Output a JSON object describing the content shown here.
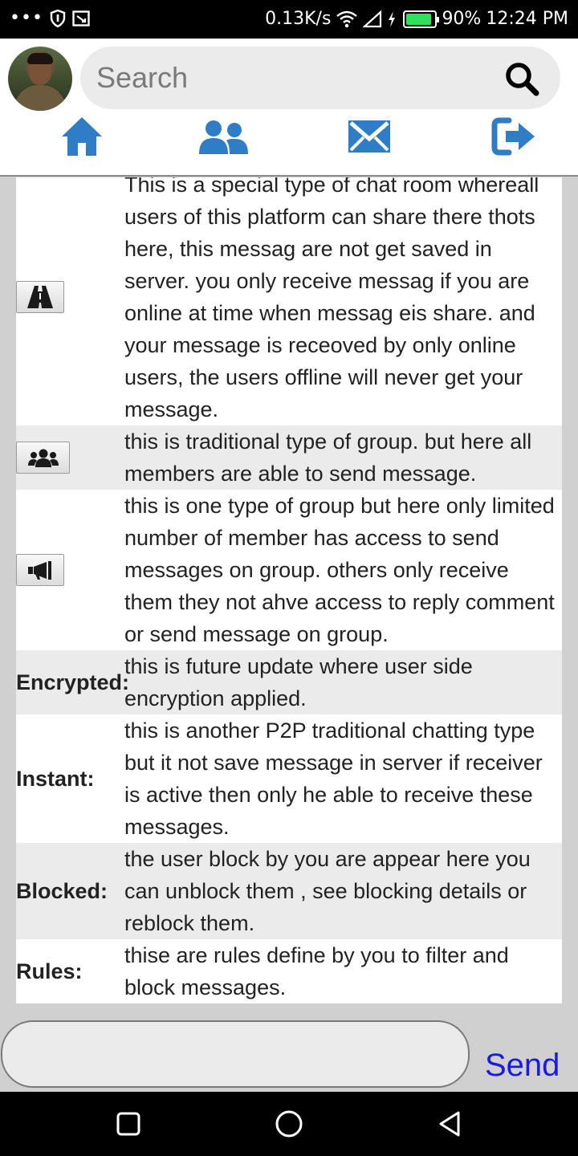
{
  "status_bar": {
    "speed": "0.13K/s",
    "battery": "90%",
    "battery_level": 0.9,
    "time": "12:24 PM",
    "icons": [
      "more-icon",
      "shield-icon",
      "cast-icon",
      "wifi-icon",
      "signal-icon",
      "charging-icon",
      "battery-icon"
    ]
  },
  "header": {
    "search_placeholder": "Search",
    "nav": [
      "home-icon",
      "users-icon",
      "envelope-icon",
      "logout-icon"
    ]
  },
  "rows": [
    {
      "label": "",
      "icon": "road-icon",
      "text": "This is a special type of chat room whereall users of this platform can share there thots here, this messag are not get saved in server. you only receive messag if you are online at time when messag eis share. and your message is receoved by only online users, the users offline will never get your message."
    },
    {
      "label": "",
      "icon": "group-icon",
      "text": "this is traditional type of group. but here all members are able to send message."
    },
    {
      "label": "",
      "icon": "bullhorn-icon",
      "text": "this is one type of group but here only limited number of member has access to send messages on group. others only receive them they not ahve access to reply comment or send message on group."
    },
    {
      "label": "Encrypted:",
      "icon": "",
      "text": "this is future update where user side encryption applied."
    },
    {
      "label": "Instant:",
      "icon": "",
      "text": "this is another P2P traditional chatting type but it not save message in server if receiver is active then only he able to receive these messages."
    },
    {
      "label": "Blocked:",
      "icon": "",
      "text": "the user block by you are appear here you can unblock them , see blocking details or reblock them."
    },
    {
      "label": "Rules:",
      "icon": "",
      "text": "thise are rules define by you to filter and block messages."
    }
  ],
  "composer": {
    "message_value": "",
    "send_label": "Send"
  },
  "colors": {
    "accent": "#2f7cc7",
    "send": "#1a1ae6",
    "row_alt": "#ebebeb"
  }
}
